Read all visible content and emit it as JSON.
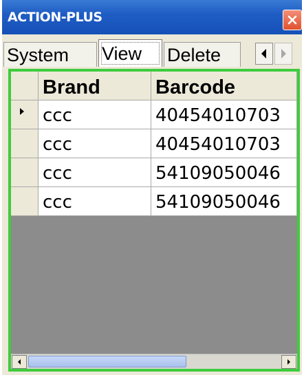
{
  "window": {
    "title": "ACTION-PLUS"
  },
  "tabs": [
    {
      "label": "System",
      "active": false
    },
    {
      "label": "View",
      "active": true
    },
    {
      "label": "Delete",
      "active": false
    }
  ],
  "tab_scroll": {
    "left_icon": "arrow-left-icon",
    "right_icon": "arrow-right-icon"
  },
  "grid": {
    "columns": [
      "Brand",
      "Barcode"
    ],
    "rows": [
      {
        "brand": "ccc",
        "barcode": "40454010703",
        "current": true
      },
      {
        "brand": "ccc",
        "barcode": "40454010703",
        "current": false
      },
      {
        "brand": "ccc",
        "barcode": "54109050046",
        "current": false
      },
      {
        "brand": "ccc",
        "barcode": "54109050046",
        "current": false
      }
    ]
  },
  "colors": {
    "title_bar": "#1f5dc4",
    "frame_border": "#3fcb3f",
    "grid_background": "#8c8c8c"
  }
}
